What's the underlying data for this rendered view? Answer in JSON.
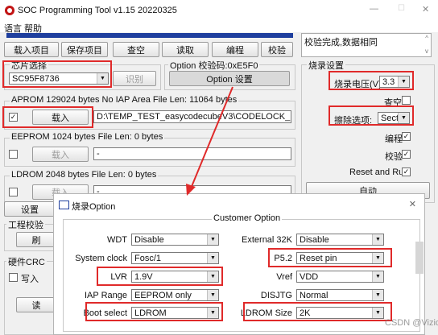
{
  "window": {
    "title": "SOC Programming Tool v1.15 20220325",
    "min": "—",
    "max": "☐",
    "close": "✕"
  },
  "menu": [
    "语言",
    "帮助"
  ],
  "toolbar": [
    "载入项目",
    "保存项目",
    "查空",
    "读取",
    "编程",
    "校验"
  ],
  "log": {
    "text": "校验完成,数据相同"
  },
  "chip": {
    "title": "芯片选择",
    "value": "SC95F8736",
    "identify": "识别"
  },
  "option": {
    "title": "Option  校验码:0xE5F0",
    "button": "Option 设置"
  },
  "burn": {
    "title": "烧录设置",
    "voltage_label": "烧录电压(V):",
    "voltage_value": "3.3",
    "blank": "查空",
    "erase_label": "擦除选项:",
    "erase_value": "Secto",
    "program": "编程",
    "verify": "校验",
    "reset_run": "Reset and Run",
    "auto": "自动"
  },
  "aprom": {
    "title": "APROM 129024 bytes  No IAP Area    File Len: 11064 bytes",
    "load": "载入",
    "path": "D:\\TEMP_TEST_easycodecubeV3\\CODELOCK_DEMO_8736"
  },
  "eeprom": {
    "title": "EEPROM 1024 bytes    File Len: 0 bytes",
    "load": "载入",
    "path": "-"
  },
  "ldrom": {
    "title": "LDROM 2048 bytes    File Len: 0 bytes",
    "load": "载入",
    "path": "-"
  },
  "left_bottom": {
    "settings": "设置",
    "engineering": "工程校验",
    "refresh": "刷",
    "hw_crc": "硬件CRC",
    "write": "写入",
    "read": "读"
  },
  "dialog": {
    "title": "烧录Option",
    "close": "✕",
    "group": "Customer Option",
    "left": [
      {
        "label": "WDT",
        "value": "Disable"
      },
      {
        "label": "System clock",
        "value": "Fosc/1"
      },
      {
        "label": "LVR",
        "value": "1.9V"
      },
      {
        "label": "IAP Range",
        "value": "EEPROM only"
      },
      {
        "label": "Boot select",
        "value": "LDROM"
      }
    ],
    "right": [
      {
        "label": "External 32K",
        "value": "Disable"
      },
      {
        "label": "P5.2",
        "value": "Reset pin"
      },
      {
        "label": "Vref",
        "value": "VDD"
      },
      {
        "label": "DISJTG",
        "value": "Normal"
      },
      {
        "label": "LDROM Size",
        "value": "2K"
      }
    ]
  },
  "watermark": "CSDN @Vizio",
  "colors": {
    "red": "#e02a2a",
    "title_bar_blue": "#1f3f9e"
  }
}
